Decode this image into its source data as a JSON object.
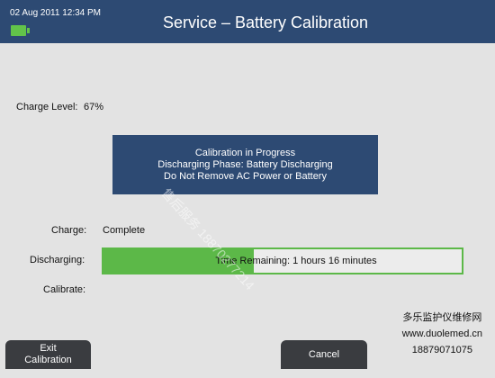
{
  "header": {
    "datetime": "02 Aug 2011 12:34 PM",
    "title": "Service – Battery Calibration",
    "battery_icon": "battery-icon"
  },
  "charge_level": {
    "label": "Charge Level:",
    "value": "67%"
  },
  "status_box": {
    "line1": "Calibration in Progress",
    "line2": "Discharging Phase: Battery Discharging",
    "line3": "Do Not Remove AC Power or Battery"
  },
  "rows": {
    "charge_label": "Charge:",
    "charge_value": "Complete",
    "discharging_label": "Discharging:",
    "calibrate_label": "Calibrate:"
  },
  "progress": {
    "text": "Time Remaining: 1 hours 16 minutes",
    "fraction": 0.42
  },
  "softkeys": {
    "exit_line1": "Exit",
    "exit_line2": "Calibration",
    "cancel": "Cancel"
  },
  "overlay": {
    "watermark": "售后服务 18870277214",
    "line1": "多乐监护仪维修网",
    "line2": "www.duolemed.cn",
    "line3": "18879071075"
  },
  "colors": {
    "header_bg": "#2d4a73",
    "progress_green": "#5cb848",
    "battery_green": "#62c34a",
    "softkey_bg": "#3a3c40"
  }
}
